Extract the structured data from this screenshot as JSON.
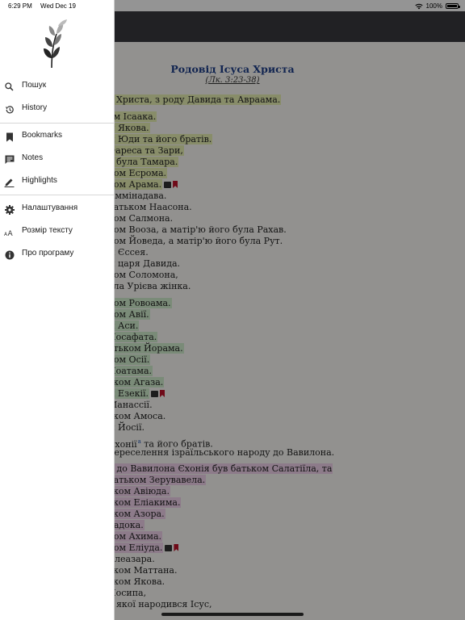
{
  "status": {
    "time": "6:29 PM",
    "date": "Wed Dec 19",
    "battery": "100%",
    "battery_level": 1.0
  },
  "reader": {
    "title": "Родовід Ісуса Христа",
    "reference": "(Лк. 3:23-38)",
    "lines": [
      {
        "text": "а Христа, з роду Давида та Авраама.",
        "hl": "yellow"
      },
      {
        "text": "ом Ісаака.",
        "hl": "yellow"
      },
      {
        "text": "м Якова.",
        "hl": "yellow"
      },
      {
        "text": "м Юди та його братів.",
        "hl": "yellow"
      },
      {
        "text": "Фареса та Зари,",
        "hl": "yellow"
      },
      {
        "text": "о була Тамара.",
        "hl": "yellow"
      },
      {
        "text": "ком Есрома.",
        "hl": "yellow"
      },
      {
        "text": "ком Арама.",
        "hl": "yellow",
        "note": true,
        "bookmark": true
      },
      {
        "text": " Аммінадава.",
        "hl": ""
      },
      {
        "text": "батьком Наасона.",
        "hl": ""
      },
      {
        "text": "ком Салмона.",
        "hl": ""
      },
      {
        "text": "ком Вооза, а матір'ю його була Рахав.",
        "hl": ""
      },
      {
        "text": "ком Йоведа, а матір'ю його була Рут.",
        "hl": ""
      },
      {
        "text": "м Єссея.",
        "hl": ""
      },
      {
        "text": "м царя Давида.",
        "hl": ""
      },
      {
        "text": "ком Соломона,",
        "hl": ""
      },
      {
        "text": "ула Урієва жінка.",
        "hl": ""
      },
      {
        "text": "ком Ровоама.",
        "hl": "green"
      },
      {
        "text": "ком Авії.",
        "hl": "green"
      },
      {
        "text": "м Аси.",
        "hl": "green"
      },
      {
        "text": "Йосафата.",
        "hl": "green"
      },
      {
        "text": "атьком Йорама.",
        "hl": "green"
      },
      {
        "text": "ком Осії.",
        "hl": "green"
      },
      {
        "text": "Йоатама.",
        "hl": "green"
      },
      {
        "text": "ьком Агаза.",
        "hl": "green"
      },
      {
        "text": "м Езекії.",
        "hl": "green",
        "note": true,
        "bookmark": true
      },
      {
        "text": " Манассії.",
        "hl": ""
      },
      {
        "text": "ьком Амоса.",
        "hl": ""
      },
      {
        "text": "м Йосії.",
        "hl": ""
      },
      {
        "text": " Єхонії",
        "hl": "",
        "sup": "а",
        "after": " та його братів."
      },
      {
        "text": " переселення ізраїльського народу до Вавилона.",
        "hl": ""
      },
      {
        "text": "я до Вавилона Єхонія був батьком Салатіїла, та",
        "hl": "pink"
      },
      {
        "text": "батьком Зерувавела.",
        "hl": "pink"
      },
      {
        "text": "ьком Авіюда.",
        "hl": "pink"
      },
      {
        "text": "ьком Еліакима.",
        "hl": "pink"
      },
      {
        "text": "ьком Азора.",
        "hl": "pink"
      },
      {
        "text": "Задока.",
        "hl": "pink"
      },
      {
        "text": "ком Ахима.",
        "hl": "pink"
      },
      {
        "text": "ком Еліуда.",
        "hl": "pink",
        "note": true,
        "bookmark": true
      },
      {
        "text": " Елеазара.",
        "hl": ""
      },
      {
        "text": "ьком Маттана.",
        "hl": ""
      },
      {
        "text": "ьком Якова.",
        "hl": ""
      },
      {
        "text": "Йосипа,",
        "hl": ""
      },
      {
        "text": "у якої народився Ісус,",
        "hl": ""
      }
    ]
  },
  "drawer": {
    "items": [
      {
        "label": "Пошук",
        "icon": "search-icon"
      },
      {
        "label": "History",
        "icon": "history-icon"
      },
      {
        "label": "Bookmarks",
        "icon": "bookmark-icon"
      },
      {
        "label": "Notes",
        "icon": "notes-icon"
      },
      {
        "label": "Highlights",
        "icon": "highlighter-icon"
      },
      {
        "label": "Налаштування",
        "icon": "gear-icon"
      },
      {
        "label": "Розмір тексту",
        "icon": "text-size-icon"
      },
      {
        "label": "Про програму",
        "icon": "info-icon"
      }
    ]
  },
  "colors": {
    "title": "#1e3f8a",
    "highlight_yellow": "#eaf3b6",
    "highlight_green": "#d3f0cf",
    "highlight_pink": "#f3d4ee",
    "bookmark": "#c0122a"
  }
}
